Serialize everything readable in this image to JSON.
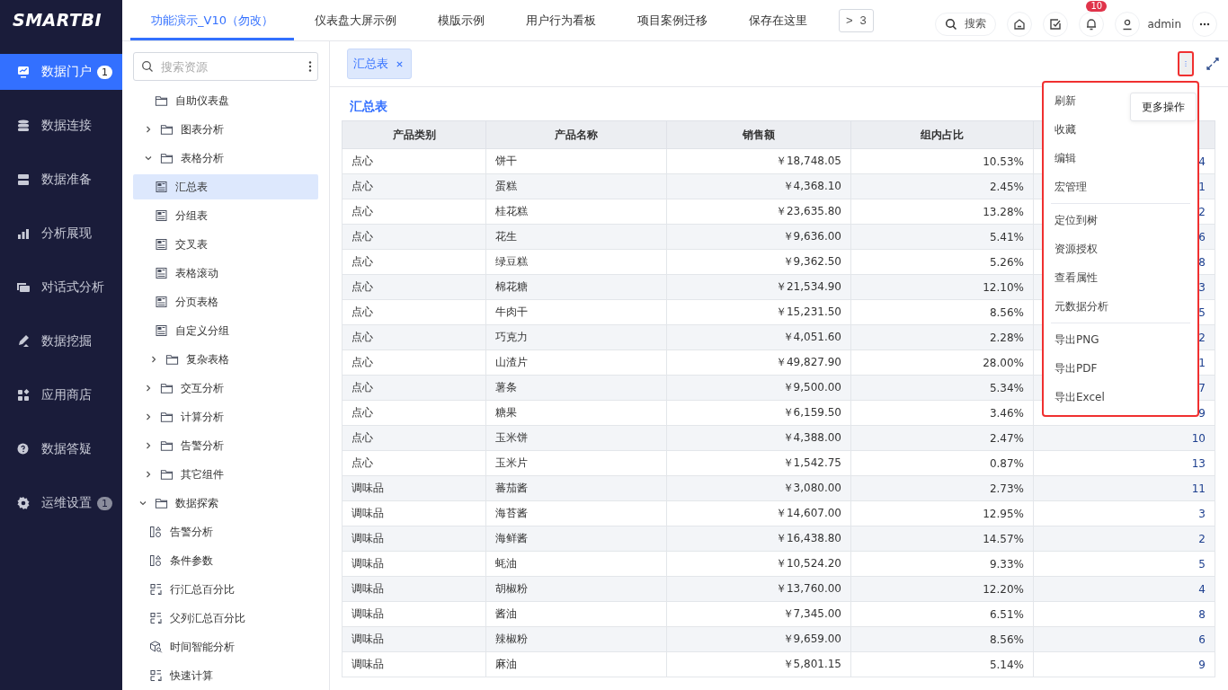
{
  "logo": "SMARTBI",
  "sidebar": {
    "items": [
      {
        "label": "数据门户",
        "selected": true,
        "badge": "1"
      },
      {
        "label": "数据连接",
        "selected": false
      },
      {
        "label": "数据准备",
        "selected": false
      },
      {
        "label": "分析展现",
        "selected": false
      },
      {
        "label": "对话式分析",
        "selected": false
      },
      {
        "label": "数据挖掘",
        "selected": false
      },
      {
        "label": "应用商店",
        "selected": false
      },
      {
        "label": "数据答疑",
        "selected": false
      },
      {
        "label": "运维设置",
        "selected": false,
        "badge": "1"
      }
    ]
  },
  "tabs": [
    {
      "label": "功能演示_V10（勿改）",
      "selected": true
    },
    {
      "label": "仪表盘大屏示例",
      "selected": false
    },
    {
      "label": "模版示例",
      "selected": false
    },
    {
      "label": "用户行为看板",
      "selected": false
    },
    {
      "label": "项目案例迁移",
      "selected": false
    },
    {
      "label": "保存在这里",
      "selected": false
    }
  ],
  "tabs_overflow": {
    "icon": ">",
    "count": "3"
  },
  "header": {
    "search": "搜索",
    "notifications": "10",
    "user": "admin"
  },
  "resource_search": {
    "placeholder": "搜索资源"
  },
  "tree": [
    {
      "label": "自助仪表盘",
      "kind": "folder",
      "selected": false,
      "children": [
        {
          "label": "图表分析",
          "kind": "folder",
          "expanded": false,
          "selected": false
        },
        {
          "label": "表格分析",
          "kind": "folder",
          "expanded": true,
          "selected": false,
          "children": [
            {
              "label": "汇总表",
              "kind": "table",
              "selected": true
            },
            {
              "label": "分组表",
              "kind": "table",
              "selected": false
            },
            {
              "label": "交叉表",
              "kind": "table",
              "selected": false
            },
            {
              "label": "表格滚动",
              "kind": "table",
              "selected": false
            },
            {
              "label": "分页表格",
              "kind": "table",
              "selected": false
            },
            {
              "label": "自定义分组",
              "kind": "table",
              "selected": false
            },
            {
              "label": "复杂表格",
              "kind": "folder",
              "expanded": false,
              "selected": false
            }
          ]
        },
        {
          "label": "交互分析",
          "kind": "folder",
          "expanded": false,
          "selected": false
        },
        {
          "label": "计算分析",
          "kind": "folder",
          "expanded": false,
          "selected": false
        },
        {
          "label": "告警分析",
          "kind": "folder",
          "expanded": false,
          "selected": false
        },
        {
          "label": "其它组件",
          "kind": "folder",
          "expanded": false,
          "selected": false
        }
      ]
    },
    {
      "label": "数据探索",
      "kind": "folder",
      "expanded": true,
      "selected": false,
      "children": [
        {
          "label": "告警分析",
          "kind": "alert",
          "selected": false
        },
        {
          "label": "条件参数",
          "kind": "alert",
          "selected": false
        },
        {
          "label": "行汇总百分比",
          "kind": "calc",
          "selected": false
        },
        {
          "label": "父列汇总百分比",
          "kind": "calc",
          "selected": false
        },
        {
          "label": "时间智能分析",
          "kind": "cube",
          "selected": false
        },
        {
          "label": "快速计算",
          "kind": "calc",
          "selected": false
        }
      ]
    }
  ],
  "open_tabs": [
    {
      "label": "汇总表",
      "selected": true
    }
  ],
  "report": {
    "title": "汇总表",
    "table": {
      "columns": [
        "产品类别",
        "产品名称",
        "销售额",
        "组内占比"
      ],
      "rows": [
        [
          "点心",
          "饼干",
          "￥18,748.05",
          "10.53%",
          "4"
        ],
        [
          "点心",
          "蛋糕",
          "￥4,368.10",
          "2.45%",
          "1"
        ],
        [
          "点心",
          "桂花糕",
          "￥23,635.80",
          "13.28%",
          "2"
        ],
        [
          "点心",
          "花生",
          "￥9,636.00",
          "5.41%",
          "6"
        ],
        [
          "点心",
          "绿豆糕",
          "￥9,362.50",
          "5.26%",
          "8"
        ],
        [
          "点心",
          "棉花糖",
          "￥21,534.90",
          "12.10%",
          "3"
        ],
        [
          "点心",
          "牛肉干",
          "￥15,231.50",
          "8.56%",
          "5"
        ],
        [
          "点心",
          "巧克力",
          "￥4,051.60",
          "2.28%",
          "2"
        ],
        [
          "点心",
          "山渣片",
          "￥49,827.90",
          "28.00%",
          "1"
        ],
        [
          "点心",
          "薯条",
          "￥9,500.00",
          "5.34%",
          "7"
        ],
        [
          "点心",
          "糖果",
          "￥6,159.50",
          "3.46%",
          "9"
        ],
        [
          "点心",
          "玉米饼",
          "￥4,388.00",
          "2.47%",
          "10"
        ],
        [
          "点心",
          "玉米片",
          "￥1,542.75",
          "0.87%",
          "13"
        ],
        [
          "调味品",
          "蕃茄酱",
          "￥3,080.00",
          "2.73%",
          "11"
        ],
        [
          "调味品",
          "海苔酱",
          "￥14,607.00",
          "12.95%",
          "3"
        ],
        [
          "调味品",
          "海鲜酱",
          "￥16,438.80",
          "14.57%",
          "2"
        ],
        [
          "调味品",
          "蚝油",
          "￥10,524.20",
          "9.33%",
          "5"
        ],
        [
          "调味品",
          "胡椒粉",
          "￥13,760.00",
          "12.20%",
          "4"
        ],
        [
          "调味品",
          "酱油",
          "￥7,345.00",
          "6.51%",
          "8"
        ],
        [
          "调味品",
          "辣椒粉",
          "￥9,659.00",
          "8.56%",
          "6"
        ],
        [
          "调味品",
          "麻油",
          "￥5,801.15",
          "5.14%",
          "9"
        ]
      ]
    }
  },
  "more_menu": {
    "tooltip": "更多操作",
    "groups": [
      [
        "刷新",
        "收藏",
        "编辑",
        "宏管理"
      ],
      [
        "定位到树",
        "资源授权",
        "查看属性",
        "元数据分析"
      ],
      [
        "导出PNG",
        "导出PDF",
        "导出Excel"
      ]
    ]
  }
}
